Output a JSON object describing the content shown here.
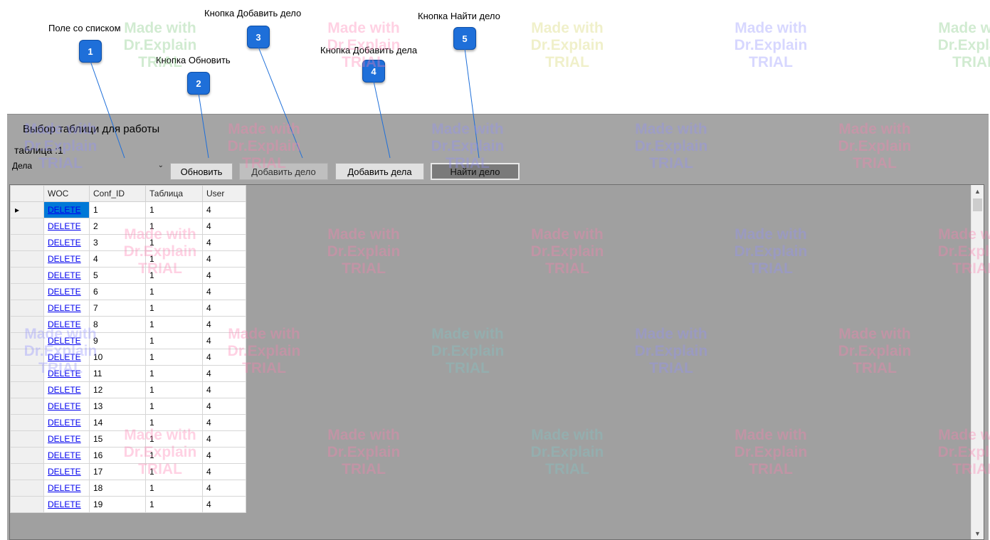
{
  "callouts": [
    {
      "num": "1",
      "label": "Поле со списком"
    },
    {
      "num": "2",
      "label": "Кнопка Обновить"
    },
    {
      "num": "3",
      "label": "Кнопка Добавить дело"
    },
    {
      "num": "4",
      "label": "Кнопка Добавить дела"
    },
    {
      "num": "5",
      "label": "Кнопка Найти дело"
    }
  ],
  "app": {
    "title": "Выбор таблици для работы",
    "table_label": "таблица :1",
    "combo_value": "Дела",
    "buttons": {
      "refresh": "Обновить",
      "add_case": "Добавить дело",
      "add_cases": "Добавить дела",
      "find_case": "Найти дело"
    }
  },
  "grid": {
    "columns": [
      "WOC",
      "Conf_ID",
      "Таблица",
      "User"
    ],
    "link_text": "DELETE",
    "rows": [
      [
        "1",
        "1",
        "4"
      ],
      [
        "2",
        "1",
        "4"
      ],
      [
        "3",
        "1",
        "4"
      ],
      [
        "4",
        "1",
        "4"
      ],
      [
        "5",
        "1",
        "4"
      ],
      [
        "6",
        "1",
        "4"
      ],
      [
        "7",
        "1",
        "4"
      ],
      [
        "8",
        "1",
        "4"
      ],
      [
        "9",
        "1",
        "4"
      ],
      [
        "10",
        "1",
        "4"
      ],
      [
        "11",
        "1",
        "4"
      ],
      [
        "12",
        "1",
        "4"
      ],
      [
        "13",
        "1",
        "4"
      ],
      [
        "14",
        "1",
        "4"
      ],
      [
        "15",
        "1",
        "4"
      ],
      [
        "16",
        "1",
        "4"
      ],
      [
        "17",
        "1",
        "4"
      ],
      [
        "18",
        "1",
        "4"
      ],
      [
        "19",
        "1",
        "4"
      ]
    ]
  },
  "watermark": [
    "Made with",
    "Dr.Explain",
    "TRIAL"
  ],
  "colors": {
    "badge": "#1e6fd9",
    "panel": "#a5a5a5",
    "selected_cell": "#0078d7"
  }
}
